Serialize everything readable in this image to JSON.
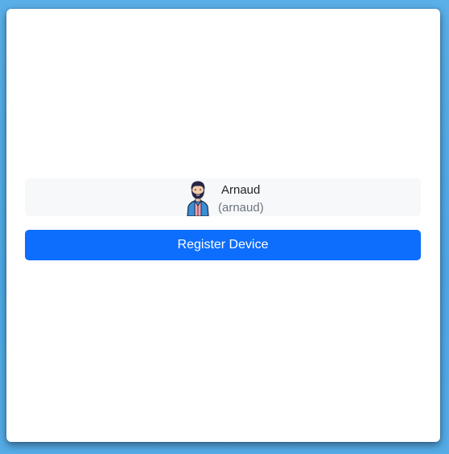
{
  "user": {
    "display_name": "Arnaud",
    "username": "(arnaud)",
    "avatar_icon": "bearded-man-avatar-icon"
  },
  "actions": {
    "register_label": "Register Device"
  },
  "colors": {
    "primary": "#0d6efd",
    "background": "#4ea8e6",
    "user_box": "#f7f8fa"
  }
}
